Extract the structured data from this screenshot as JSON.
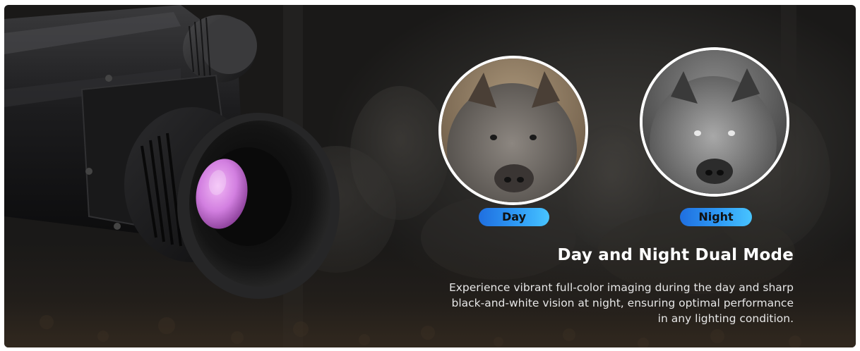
{
  "banner": {
    "day_label": "Day",
    "night_label": "Night",
    "headline": "Day and Night Dual Mode",
    "description": "Experience vibrant full-color imaging during the day and sharp black-and-white vision at night, ensuring optimal performance in any lighting condition."
  },
  "colors": {
    "pill_start": "#1f6fe0",
    "pill_end": "#48c4ff",
    "lens_pink": "#d27fe0",
    "background": "#1b1a18"
  }
}
